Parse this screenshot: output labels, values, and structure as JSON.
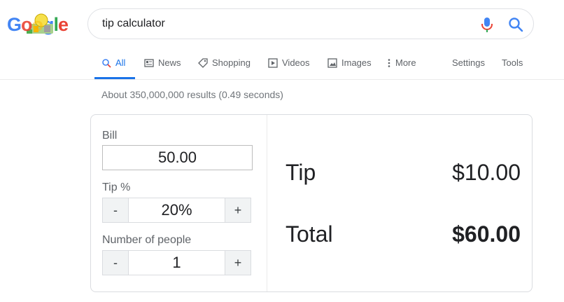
{
  "logo": {
    "letters": [
      "G",
      "o",
      "o",
      "g",
      "l",
      "e"
    ],
    "colors": [
      "#4285f4",
      "#ea4335",
      "#fbbc05",
      "#4285f4",
      "#34a853",
      "#ea4335"
    ]
  },
  "search": {
    "value": "tip calculator"
  },
  "tabs": [
    {
      "label": "All",
      "icon": "search-icon",
      "active": true
    },
    {
      "label": "News",
      "icon": "news-icon"
    },
    {
      "label": "Shopping",
      "icon": "tag-icon"
    },
    {
      "label": "Videos",
      "icon": "play-icon"
    },
    {
      "label": "Images",
      "icon": "image-icon"
    },
    {
      "label": "More",
      "icon": "dots-vertical-icon"
    },
    {
      "label": "Settings"
    },
    {
      "label": "Tools"
    }
  ],
  "stats": "About 350,000,000 results (0.49 seconds)",
  "calculator": {
    "bill_label": "Bill",
    "bill_value": "50.00",
    "tip_label": "Tip %",
    "tip_value": "20%",
    "people_label": "Number of people",
    "people_value": "1",
    "minus": "-",
    "plus": "+",
    "tip_result_label": "Tip",
    "tip_result_value": "$10.00",
    "total_label": "Total",
    "total_value": "$60.00"
  },
  "colors": {
    "accent": "#1a73e8",
    "border": "#dadce0",
    "muted": "#70757a"
  }
}
